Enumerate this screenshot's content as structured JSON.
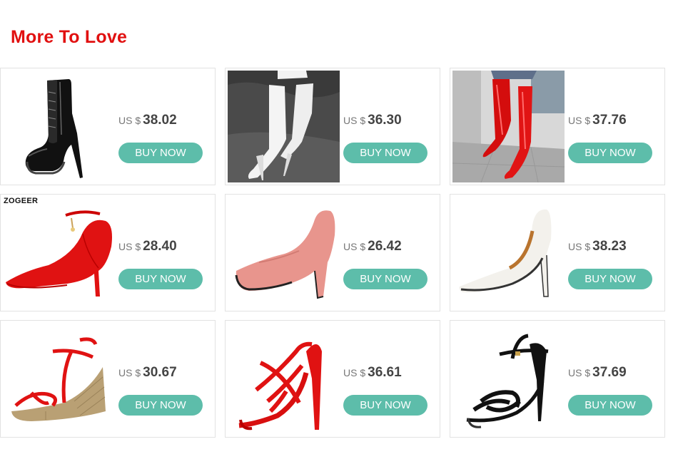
{
  "section": {
    "title": "More To Love"
  },
  "brand_tag": "ZOGEER",
  "products": [
    {
      "currency": "US $",
      "price": "38.02",
      "buy_label": "BUY NOW",
      "icon": "black-platform-ankle-boot"
    },
    {
      "currency": "US $",
      "price": "36.30",
      "buy_label": "BUY NOW",
      "icon": "white-thigh-high-boot"
    },
    {
      "currency": "US $",
      "price": "37.76",
      "buy_label": "BUY NOW",
      "icon": "red-thigh-high-boot"
    },
    {
      "currency": "US $",
      "price": "28.40",
      "buy_label": "BUY NOW",
      "icon": "red-ankle-strap-pump"
    },
    {
      "currency": "US $",
      "price": "26.42",
      "buy_label": "BUY NOW",
      "icon": "pink-platform-pump"
    },
    {
      "currency": "US $",
      "price": "38.23",
      "buy_label": "BUY NOW",
      "icon": "white-pointed-pump"
    },
    {
      "currency": "US $",
      "price": "30.67",
      "buy_label": "BUY NOW",
      "icon": "red-espadrille-wedge-sandal"
    },
    {
      "currency": "US $",
      "price": "36.61",
      "buy_label": "BUY NOW",
      "icon": "red-strappy-peep-toe-heel"
    },
    {
      "currency": "US $",
      "price": "37.69",
      "buy_label": "BUY NOW",
      "icon": "black-strappy-sandal"
    }
  ],
  "colors": {
    "title": "#e11010",
    "button": "#5dbdaa",
    "border": "#e2e2e2"
  }
}
